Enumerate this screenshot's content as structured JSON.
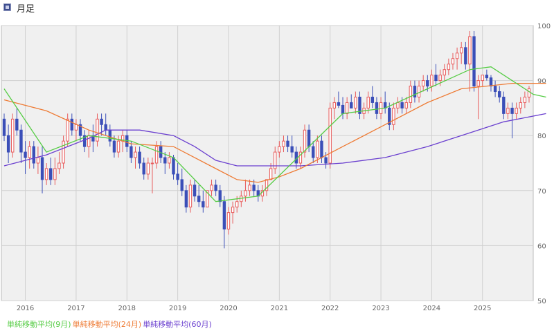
{
  "header": {
    "title": "月足"
  },
  "legend": [
    {
      "label": "単純移動平均(9月)",
      "color": "#55cc44"
    },
    {
      "label": "単純移動平均(24月)",
      "color": "#ee7a33"
    },
    {
      "label": "単純移動平均(60月)",
      "color": "#6a3fcf"
    }
  ],
  "colors": {
    "up": "#e85a5a",
    "down": "#3b4fb8",
    "plot_bg": "#f0f0f0",
    "grid": "#d0d0d0"
  },
  "chart_data": {
    "type": "candlestick",
    "y_ticks": [
      "50",
      "60",
      "70",
      "80",
      "90",
      "100"
    ],
    "ylim": [
      50,
      100
    ],
    "x_ticks": [
      "2016",
      "2017",
      "2018",
      "2019",
      "2020",
      "2021",
      "2022",
      "2023",
      "2024",
      "2025"
    ],
    "first_month": "2015-08",
    "candles": [
      {
        "o": 83,
        "h": 84,
        "l": 79,
        "c": 80
      },
      {
        "o": 80,
        "h": 82,
        "l": 75,
        "c": 77
      },
      {
        "o": 77,
        "h": 84,
        "l": 76,
        "c": 83
      },
      {
        "o": 83,
        "h": 85,
        "l": 80,
        "c": 81
      },
      {
        "o": 81,
        "h": 82,
        "l": 75,
        "c": 77
      },
      {
        "o": 77,
        "h": 79,
        "l": 73,
        "c": 76
      },
      {
        "o": 76,
        "h": 79,
        "l": 74,
        "c": 78
      },
      {
        "o": 78,
        "h": 79,
        "l": 74,
        "c": 75
      },
      {
        "o": 75,
        "h": 78,
        "l": 73,
        "c": 76
      },
      {
        "o": 76,
        "h": 78,
        "l": 69.5,
        "c": 72
      },
      {
        "o": 72,
        "h": 75,
        "l": 71,
        "c": 74
      },
      {
        "o": 74,
        "h": 76,
        "l": 71,
        "c": 72
      },
      {
        "o": 72,
        "h": 76,
        "l": 71,
        "c": 74
      },
      {
        "o": 74,
        "h": 77,
        "l": 73,
        "c": 75
      },
      {
        "o": 75,
        "h": 80,
        "l": 74,
        "c": 79
      },
      {
        "o": 79,
        "h": 84,
        "l": 78,
        "c": 83
      },
      {
        "o": 83,
        "h": 84,
        "l": 80,
        "c": 81
      },
      {
        "o": 81,
        "h": 83,
        "l": 79,
        "c": 82
      },
      {
        "o": 82,
        "h": 83,
        "l": 79,
        "c": 80
      },
      {
        "o": 80,
        "h": 81,
        "l": 77,
        "c": 78
      },
      {
        "o": 78,
        "h": 81,
        "l": 76,
        "c": 80
      },
      {
        "o": 80,
        "h": 82,
        "l": 77,
        "c": 79
      },
      {
        "o": 79,
        "h": 84,
        "l": 78,
        "c": 83
      },
      {
        "o": 83,
        "h": 84,
        "l": 80,
        "c": 82
      },
      {
        "o": 82,
        "h": 84,
        "l": 80,
        "c": 81
      },
      {
        "o": 81,
        "h": 82,
        "l": 78,
        "c": 79
      },
      {
        "o": 79,
        "h": 80,
        "l": 76,
        "c": 77
      },
      {
        "o": 77,
        "h": 80,
        "l": 76,
        "c": 79
      },
      {
        "o": 79,
        "h": 81,
        "l": 77,
        "c": 80
      },
      {
        "o": 80,
        "h": 81,
        "l": 77,
        "c": 78
      },
      {
        "o": 78,
        "h": 79,
        "l": 75,
        "c": 76
      },
      {
        "o": 76,
        "h": 78,
        "l": 74,
        "c": 77
      },
      {
        "o": 77,
        "h": 78,
        "l": 74,
        "c": 75
      },
      {
        "o": 75,
        "h": 76,
        "l": 72,
        "c": 73
      },
      {
        "o": 73,
        "h": 76,
        "l": 72,
        "c": 75
      },
      {
        "o": 75,
        "h": 76,
        "l": 69.5,
        "c": 75
      },
      {
        "o": 75,
        "h": 79,
        "l": 74,
        "c": 78
      },
      {
        "o": 78,
        "h": 79,
        "l": 75,
        "c": 76
      },
      {
        "o": 76,
        "h": 77,
        "l": 73,
        "c": 75
      },
      {
        "o": 75,
        "h": 77,
        "l": 74,
        "c": 76
      },
      {
        "o": 76,
        "h": 76.5,
        "l": 72,
        "c": 73
      },
      {
        "o": 73,
        "h": 75,
        "l": 71,
        "c": 72
      },
      {
        "o": 72,
        "h": 74,
        "l": 69,
        "c": 70
      },
      {
        "o": 70,
        "h": 71,
        "l": 66,
        "c": 67
      },
      {
        "o": 67,
        "h": 72,
        "l": 66,
        "c": 71
      },
      {
        "o": 71,
        "h": 72,
        "l": 68,
        "c": 69
      },
      {
        "o": 69,
        "h": 71,
        "l": 67,
        "c": 68
      },
      {
        "o": 68,
        "h": 70,
        "l": 66,
        "c": 67
      },
      {
        "o": 67,
        "h": 70,
        "l": 67,
        "c": 70
      },
      {
        "o": 70,
        "h": 72,
        "l": 69,
        "c": 71
      },
      {
        "o": 71,
        "h": 72,
        "l": 69,
        "c": 70
      },
      {
        "o": 70,
        "h": 71,
        "l": 67,
        "c": 68
      },
      {
        "o": 68,
        "h": 69,
        "l": 59.5,
        "c": 63
      },
      {
        "o": 63,
        "h": 67,
        "l": 62,
        "c": 66
      },
      {
        "o": 66,
        "h": 68,
        "l": 64,
        "c": 67
      },
      {
        "o": 67,
        "h": 69,
        "l": 66,
        "c": 68
      },
      {
        "o": 68,
        "h": 70,
        "l": 67,
        "c": 69
      },
      {
        "o": 69,
        "h": 72,
        "l": 68,
        "c": 70
      },
      {
        "o": 70,
        "h": 72,
        "l": 69,
        "c": 71
      },
      {
        "o": 71,
        "h": 72,
        "l": 69,
        "c": 70
      },
      {
        "o": 70,
        "h": 71,
        "l": 68,
        "c": 69
      },
      {
        "o": 69,
        "h": 71,
        "l": 68,
        "c": 70
      },
      {
        "o": 70,
        "h": 72,
        "l": 69,
        "c": 72
      },
      {
        "o": 72,
        "h": 75,
        "l": 72,
        "c": 74
      },
      {
        "o": 74,
        "h": 78,
        "l": 73,
        "c": 77
      },
      {
        "o": 77,
        "h": 79,
        "l": 76,
        "c": 78
      },
      {
        "o": 78,
        "h": 80,
        "l": 77,
        "c": 79
      },
      {
        "o": 79,
        "h": 80,
        "l": 77,
        "c": 78
      },
      {
        "o": 78,
        "h": 80,
        "l": 76,
        "c": 77
      },
      {
        "o": 77,
        "h": 78,
        "l": 74,
        "c": 75
      },
      {
        "o": 75,
        "h": 78,
        "l": 74,
        "c": 77
      },
      {
        "o": 77,
        "h": 82,
        "l": 76,
        "c": 81
      },
      {
        "o": 81,
        "h": 82,
        "l": 77,
        "c": 78
      },
      {
        "o": 78,
        "h": 79,
        "l": 75,
        "c": 76
      },
      {
        "o": 76,
        "h": 80,
        "l": 75,
        "c": 79
      },
      {
        "o": 79,
        "h": 80,
        "l": 75,
        "c": 76
      },
      {
        "o": 76,
        "h": 77,
        "l": 74,
        "c": 75
      },
      {
        "o": 75,
        "h": 86,
        "l": 74,
        "c": 85
      },
      {
        "o": 85,
        "h": 87,
        "l": 83,
        "c": 86
      },
      {
        "o": 86,
        "h": 88,
        "l": 85,
        "c": 85.5
      },
      {
        "o": 85.5,
        "h": 87,
        "l": 83,
        "c": 84
      },
      {
        "o": 84,
        "h": 87,
        "l": 83,
        "c": 86
      },
      {
        "o": 86,
        "h": 87.5,
        "l": 85,
        "c": 85
      },
      {
        "o": 85,
        "h": 88,
        "l": 84,
        "c": 87
      },
      {
        "o": 87,
        "h": 88,
        "l": 83,
        "c": 84
      },
      {
        "o": 84,
        "h": 86,
        "l": 83,
        "c": 85
      },
      {
        "o": 85,
        "h": 88,
        "l": 84,
        "c": 87
      },
      {
        "o": 87,
        "h": 89,
        "l": 85,
        "c": 86
      },
      {
        "o": 86,
        "h": 87,
        "l": 83,
        "c": 84
      },
      {
        "o": 84,
        "h": 87,
        "l": 83,
        "c": 86
      },
      {
        "o": 86,
        "h": 88,
        "l": 84,
        "c": 85
      },
      {
        "o": 85,
        "h": 86,
        "l": 81,
        "c": 82
      },
      {
        "o": 82,
        "h": 86,
        "l": 81,
        "c": 85
      },
      {
        "o": 85,
        "h": 87,
        "l": 84,
        "c": 86
      },
      {
        "o": 86,
        "h": 87,
        "l": 84,
        "c": 85
      },
      {
        "o": 85,
        "h": 87,
        "l": 84,
        "c": 86
      },
      {
        "o": 86,
        "h": 90,
        "l": 85,
        "c": 89
      },
      {
        "o": 89,
        "h": 90,
        "l": 86,
        "c": 87
      },
      {
        "o": 87,
        "h": 90,
        "l": 86,
        "c": 89
      },
      {
        "o": 89,
        "h": 91,
        "l": 88,
        "c": 90
      },
      {
        "o": 90,
        "h": 91,
        "l": 88,
        "c": 89
      },
      {
        "o": 89,
        "h": 92,
        "l": 88,
        "c": 91
      },
      {
        "o": 91,
        "h": 93,
        "l": 89,
        "c": 90
      },
      {
        "o": 90,
        "h": 92,
        "l": 89,
        "c": 91
      },
      {
        "o": 91,
        "h": 93,
        "l": 90,
        "c": 92
      },
      {
        "o": 92,
        "h": 94,
        "l": 91,
        "c": 93
      },
      {
        "o": 93,
        "h": 95,
        "l": 92,
        "c": 94
      },
      {
        "o": 94,
        "h": 96,
        "l": 92,
        "c": 95
      },
      {
        "o": 95,
        "h": 97,
        "l": 93,
        "c": 96
      },
      {
        "o": 96,
        "h": 97,
        "l": 92,
        "c": 93
      },
      {
        "o": 93,
        "h": 99,
        "l": 88,
        "c": 98
      },
      {
        "o": 98,
        "h": 99,
        "l": 88,
        "c": 89
      },
      {
        "o": 89,
        "h": 91,
        "l": 83,
        "c": 90
      },
      {
        "o": 90,
        "h": 91,
        "l": 89,
        "c": 91
      },
      {
        "o": 91,
        "h": 92,
        "l": 90,
        "c": 90.5
      },
      {
        "o": 90.5,
        "h": 91,
        "l": 88,
        "c": 89
      },
      {
        "o": 89,
        "h": 90,
        "l": 87,
        "c": 88
      },
      {
        "o": 88,
        "h": 89,
        "l": 86,
        "c": 87
      },
      {
        "o": 87,
        "h": 88,
        "l": 83,
        "c": 84
      },
      {
        "o": 84,
        "h": 86,
        "l": 83,
        "c": 85
      },
      {
        "o": 85,
        "h": 86,
        "l": 79.5,
        "c": 84
      },
      {
        "o": 84,
        "h": 86,
        "l": 83,
        "c": 85
      },
      {
        "o": 85,
        "h": 87,
        "l": 84,
        "c": 86
      },
      {
        "o": 86,
        "h": 88,
        "l": 85,
        "c": 87
      },
      {
        "o": 87,
        "h": 89,
        "l": 86,
        "c": 88.5
      }
    ],
    "ma9": [
      [
        0,
        88.5
      ],
      [
        10,
        77
      ],
      [
        20,
        80
      ],
      [
        30,
        79
      ],
      [
        40,
        76
      ],
      [
        50,
        68
      ],
      [
        60,
        69
      ],
      [
        70,
        76.5
      ],
      [
        80,
        84
      ],
      [
        90,
        85
      ],
      [
        100,
        88.5
      ],
      [
        110,
        92
      ],
      [
        115,
        92.5
      ],
      [
        125,
        87.5
      ],
      [
        128,
        87
      ]
    ],
    "ma24": [
      [
        0,
        86.5
      ],
      [
        10,
        84.5
      ],
      [
        20,
        81
      ],
      [
        30,
        78.5
      ],
      [
        40,
        78
      ],
      [
        50,
        74
      ],
      [
        55,
        72
      ],
      [
        60,
        71.5
      ],
      [
        65,
        72.5
      ],
      [
        70,
        74
      ],
      [
        80,
        78
      ],
      [
        90,
        82
      ],
      [
        100,
        86
      ],
      [
        108,
        88.5
      ],
      [
        114,
        89
      ],
      [
        120,
        89.5
      ],
      [
        128,
        89.5
      ]
    ],
    "ma60": [
      [
        0,
        74.5
      ],
      [
        10,
        76.5
      ],
      [
        20,
        79.5
      ],
      [
        24,
        81
      ],
      [
        32,
        81
      ],
      [
        40,
        80
      ],
      [
        45,
        78
      ],
      [
        50,
        75.5
      ],
      [
        55,
        74.5
      ],
      [
        60,
        74.5
      ],
      [
        70,
        74.5
      ],
      [
        80,
        75
      ],
      [
        90,
        76
      ],
      [
        100,
        78
      ],
      [
        110,
        80.5
      ],
      [
        118,
        82.5
      ],
      [
        128,
        84
      ]
    ]
  }
}
